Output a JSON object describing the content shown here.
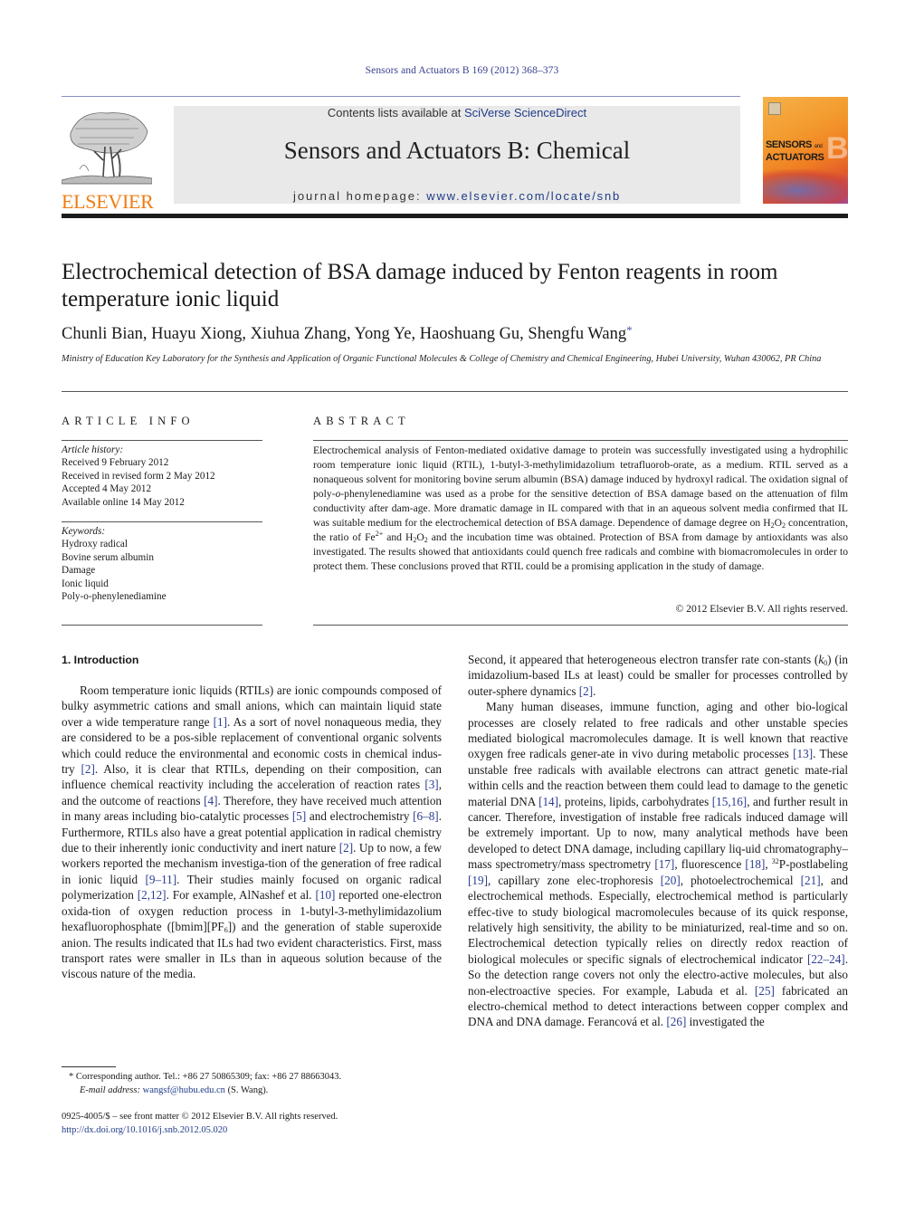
{
  "running_header": "Sensors and Actuators B 169 (2012) 368–373",
  "masthead": {
    "publisher_wordmark": "ELSEVIER",
    "contents_prefix": "Contents lists available at ",
    "contents_link": "SciVerse ScienceDirect",
    "journal_title": "Sensors and Actuators B: Chemical",
    "homepage_prefix": "journal homepage: ",
    "homepage_link": "www.elsevier.com/locate/snb",
    "cover_title_line1": "SENSORS",
    "cover_title_and": "and",
    "cover_title_line2": "ACTUATORS",
    "cover_letter": "B",
    "accent_color": "#f07c10",
    "link_color": "#1f3c88"
  },
  "article": {
    "title": "Electrochemical detection of BSA damage induced by Fenton reagents in room temperature ionic liquid",
    "authors": "Chunli Bian, Huayu Xiong, Xiuhua Zhang, Yong Ye, Haoshuang Gu, Shengfu Wang",
    "corresponding_mark": "*",
    "affiliation": "Ministry of Education Key Laboratory for the Synthesis and Application of Organic Functional Molecules & College of Chemistry and Chemical Engineering, Hubei University, Wuhan 430062, PR China"
  },
  "article_info": {
    "heading": "ARTICLE INFO",
    "history_label": "Article history:",
    "history": [
      "Received 9 February 2012",
      "Received in revised form 2 May 2012",
      "Accepted 4 May 2012",
      "Available online 14 May 2012"
    ],
    "keywords_label": "Keywords:",
    "keywords": [
      "Hydroxy radical",
      "Bovine serum albumin",
      "Damage",
      "Ionic liquid",
      "Poly-o-phenylenediamine"
    ]
  },
  "abstract": {
    "heading": "ABSTRACT",
    "parts": {
      "a": "Electrochemical analysis of Fenton-mediated oxidative damage to protein was successfully investigated using a hydrophilic room temperature ionic liquid (RTIL), 1-butyl-3-methylimidazolium tetrafluorob-orate, as a medium. RTIL served as a nonaqueous solvent for monitoring bovine serum albumin (BSA) damage induced by hydroxyl radical. The oxidation signal of poly-",
      "o": "o",
      "b": "-phenylenediamine was used as a probe for the sensitive detection of BSA damage based on the attenuation of film conductivity after dam-age. More dramatic damage in IL compared with that in an aqueous solvent media confirmed that IL was suitable medium for the electrochemical detection of BSA damage. Dependence of damage degree on ",
      "h": "H",
      "two": "2",
      "oxy": "O",
      "c": " concentration, the ratio of Fe",
      "fe_charge": "2+",
      "d": " and ",
      "e": " and the incubation time was obtained. Protection of BSA from damage by antioxidants was also investigated. The results showed that antioxidants could quench free radicals and combine with biomacromolecules in order to protect them. These conclusions proved that RTIL could be a promising application in the study of damage."
    },
    "copyright": "© 2012 Elsevier B.V. All rights reserved."
  },
  "introduction": {
    "heading": "1.  Introduction",
    "left_column": [
      {
        "t": "Room temperature ionic liquids (RTILs) are ionic compounds composed of bulky asymmetric cations and small anions, which can maintain liquid state over a wide temperature range "
      },
      {
        "r": "[1]"
      },
      {
        "t": ". As a sort of novel nonaqueous media, they are considered to be a pos-sible replacement of conventional organic solvents which could reduce the environmental and economic costs in chemical indus-try "
      },
      {
        "r": "[2]"
      },
      {
        "t": ". Also, it is clear that RTILs, depending on their composition, can influence chemical reactivity including the acceleration of reaction rates "
      },
      {
        "r": "[3]"
      },
      {
        "t": ", and the outcome of reactions "
      },
      {
        "r": "[4]"
      },
      {
        "t": ". Therefore, they have received much attention in many areas including bio-catalytic processes "
      },
      {
        "r": "[5]"
      },
      {
        "t": " and electrochemistry "
      },
      {
        "r": "[6–8]"
      },
      {
        "t": ". Furthermore, RTILs also have a great potential application in radical chemistry due to their inherently ionic conductivity and inert nature "
      },
      {
        "r": "[2]"
      },
      {
        "t": ". Up to now, a few workers reported the mechanism investiga-tion of the generation of free radical in ionic liquid "
      },
      {
        "r": "[9–11]"
      },
      {
        "t": ". Their studies mainly focused on organic radical polymerization "
      },
      {
        "r": "[2,12]"
      },
      {
        "t": ". For example, AlNashef et al. "
      },
      {
        "r": "[10]"
      },
      {
        "t": " reported one-electron oxida-tion of oxygen reduction process in 1-butyl-3-methylimidazolium hexafluorophosphate ([bmim][PF"
      },
      {
        "sub": "6"
      },
      {
        "t": "]) and the generation of stable superoxide anion. The results indicated that ILs had two evident characteristics. First, mass transport rates were smaller in ILs than in aqueous solution because of the viscous nature of the media."
      }
    ],
    "right_para1": [
      {
        "t": "Second, it appeared that heterogeneous electron transfer rate con-stants ("
      },
      {
        "i": "k"
      },
      {
        "sub": "0"
      },
      {
        "t": ") (in imidazolium-based ILs at least) could be smaller for processes controlled by outer-sphere dynamics "
      },
      {
        "r": "[2]"
      },
      {
        "t": "."
      }
    ],
    "right_para2": [
      {
        "t": "Many human diseases, immune function, aging and other bio-logical processes are closely related to free radicals and other unstable species mediated biological macromolecules damage. It is well known that reactive oxygen free radicals gener-ate in vivo during metabolic processes "
      },
      {
        "r": "[13]"
      },
      {
        "t": ". These unstable free radicals with available electrons can attract genetic mate-rial within cells and the reaction between them could lead to damage to the genetic material DNA "
      },
      {
        "r": "[14]"
      },
      {
        "t": ", proteins, lipids, carbohydrates "
      },
      {
        "r": "[15,16]"
      },
      {
        "t": ", and further result in cancer. Therefore, investigation of instable free radicals induced damage will be extremely important. Up to now, many analytical methods have been developed to detect DNA damage, including capillary liq-uid chromatography–mass spectrometry/mass spectrometry "
      },
      {
        "r": "[17]"
      },
      {
        "t": ", fluorescence "
      },
      {
        "r": "[18]"
      },
      {
        "t": ", "
      },
      {
        "sup": "32"
      },
      {
        "t": "P-postlabeling "
      },
      {
        "r": "[19]"
      },
      {
        "t": ", capillary zone elec-trophoresis "
      },
      {
        "r": "[20]"
      },
      {
        "t": ", photoelectrochemical "
      },
      {
        "r": "[21]"
      },
      {
        "t": ", and electrochemical methods. Especially, electrochemical method is particularly effec-tive to study biological macromolecules because of its quick response, relatively high sensitivity, the ability to be miniaturized, real-time and so on. Electrochemical detection typically relies on directly redox reaction of biological molecules or specific signals of electrochemical indicator "
      },
      {
        "r": "[22–24]"
      },
      {
        "t": ". So the detection range covers not only the electro-active molecules, but also non-electroactive species. For example, Labuda et al. "
      },
      {
        "r": "[25]"
      },
      {
        "t": " fabricated an electro-chemical method to detect interactions between copper complex and DNA and DNA damage. Ferancová et al. "
      },
      {
        "r": "[26]"
      },
      {
        "t": " investigated the"
      }
    ]
  },
  "footnotes": {
    "mark": "*",
    "corresponding": " Corresponding author. Tel.: +86 27 50865309; fax: +86 27 88663043.",
    "email_label": "E-mail address:",
    "email": "wangsf@hubu.edu.cn",
    "email_suffix": " (S. Wang)."
  },
  "front_matter": {
    "issn_line": "0925-4005/$ – see front matter © 2012 Elsevier B.V. All rights reserved.",
    "doi": "http://dx.doi.org/10.1016/j.snb.2012.05.020"
  }
}
